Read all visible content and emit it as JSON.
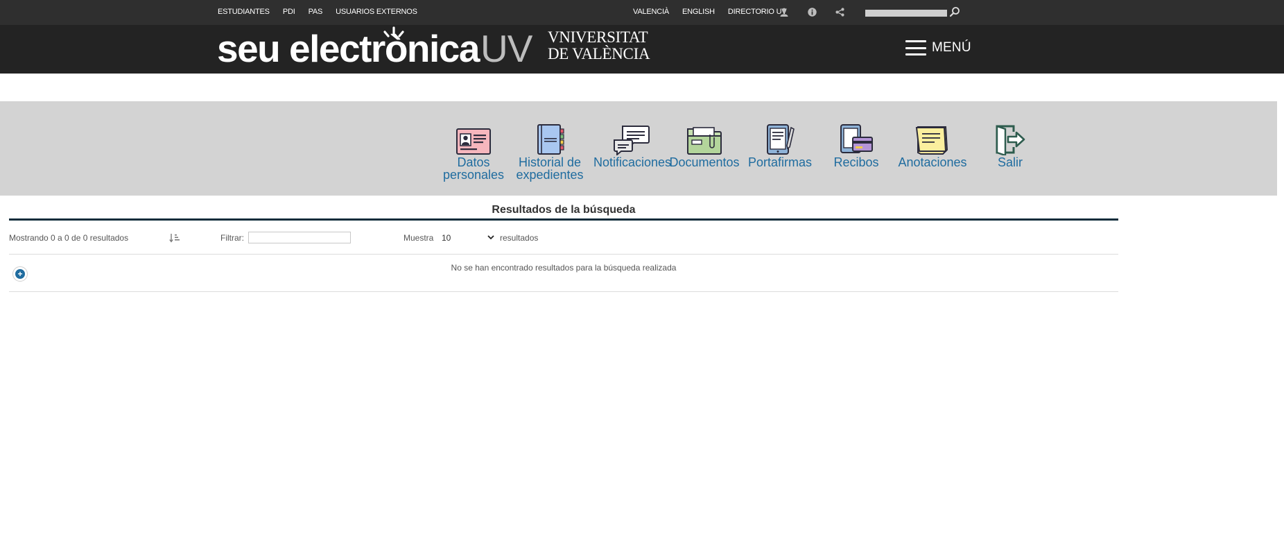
{
  "topbar": {
    "left_links": [
      "ESTUDIANTES",
      "PDI",
      "PAS",
      "USUARIOS EXTERNOS"
    ],
    "right_links": [
      "VALENCIÀ",
      "ENGLISH",
      "DIRECTORIO UV"
    ],
    "icons": [
      "user-icon",
      "info-icon",
      "share-icon"
    ],
    "search_placeholder": ""
  },
  "header": {
    "brand_main": "seu electrònica",
    "brand_suffix": "UV",
    "university_line1": "VNIVERSITAT",
    "university_line2": "DE VALÈNCIA",
    "menu_label": "MENÚ"
  },
  "nav": {
    "items": [
      {
        "label": "Datos\npersonales",
        "icon": "id-card-icon"
      },
      {
        "label": "Historial de\nexpedientes",
        "icon": "notebook-icon"
      },
      {
        "label": "Notificaciones",
        "icon": "chat-bubbles-icon"
      },
      {
        "label": "Documentos",
        "icon": "folder-icon"
      },
      {
        "label": "Portafirmas",
        "icon": "tablet-pen-icon"
      },
      {
        "label": "Recibos",
        "icon": "receipt-card-icon"
      },
      {
        "label": "Anotaciones",
        "icon": "sticky-note-icon"
      },
      {
        "label": "Salir",
        "icon": "logout-icon"
      }
    ]
  },
  "results": {
    "title": "Resultados de la búsqueda",
    "showing": "Mostrando 0 a 0 de 0 resultados",
    "filter_label": "Filtrar:",
    "filter_value": "",
    "show_label": "Muestra",
    "show_value": "10",
    "show_suffix": "resultados",
    "empty_message": "No se han encontrado resultados para la búsqueda realizada",
    "add_symbol": "+"
  },
  "colors": {
    "topbar_bg": "#2f2f2f",
    "header_bg": "#232323",
    "nav_band_bg": "#d3d3d3",
    "link_blue": "#1f6c9f",
    "rule_dark": "#0d2b3a"
  }
}
